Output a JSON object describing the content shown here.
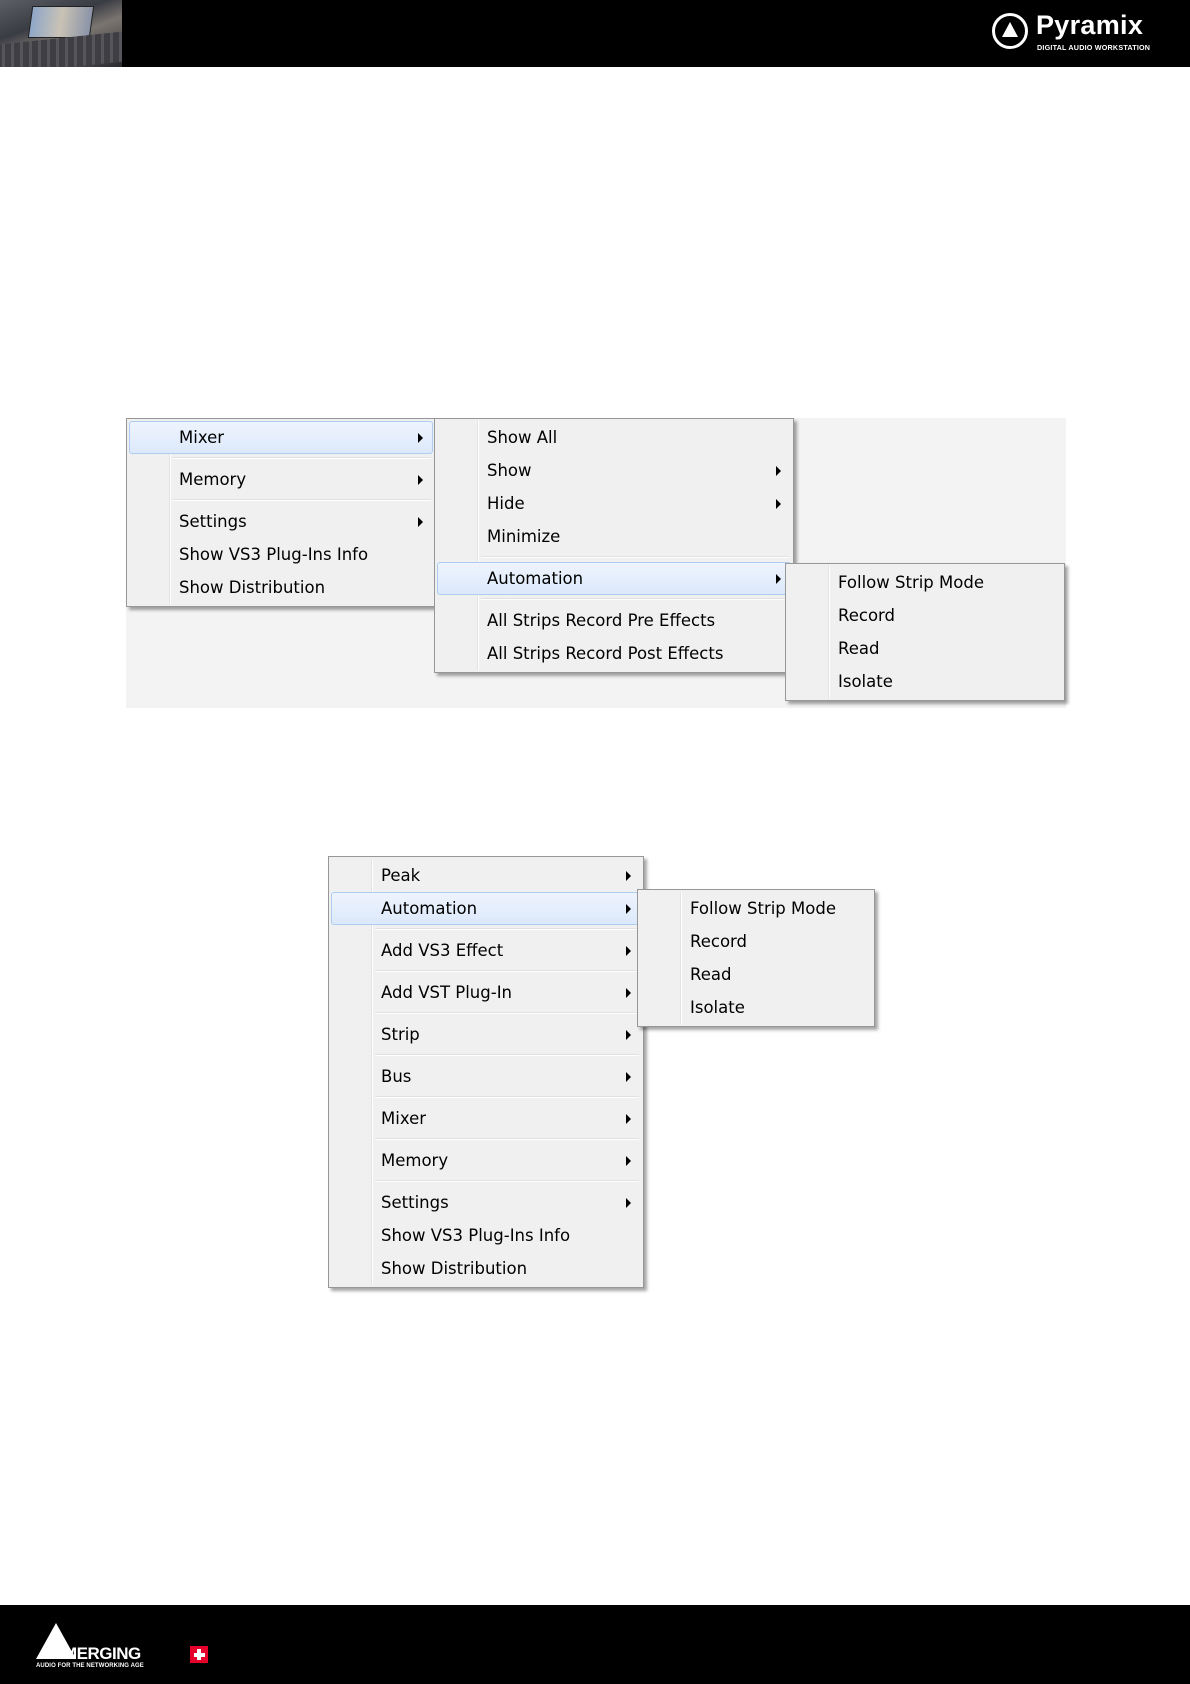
{
  "header": {
    "brand_name": "Pyramix",
    "brand_subtitle": "DIGITAL AUDIO WORKSTATION",
    "photo_icon": "studio-photo",
    "logo_icon": "pyramix-triangle-logo"
  },
  "footer": {
    "brand_name": "MERGING",
    "brand_subtitle": "AUDIO FOR THE NETWORKING AGE",
    "logo_icon": "merging-triangle-logo",
    "flag_icon": "swiss-cross"
  },
  "figure1": {
    "main_menu": [
      {
        "label": "Mixer",
        "submenu": true,
        "highlighted": true
      },
      {
        "separator": true
      },
      {
        "label": "Memory",
        "submenu": true
      },
      {
        "separator": true
      },
      {
        "label": "Settings",
        "submenu": true
      },
      {
        "label": "Show VS3 Plug-Ins Info",
        "submenu": false
      },
      {
        "label": "Show Distribution",
        "submenu": false
      }
    ],
    "mixer_submenu": [
      {
        "label": "Show All",
        "submenu": false
      },
      {
        "label": "Show",
        "submenu": true
      },
      {
        "label": "Hide",
        "submenu": true
      },
      {
        "label": "Minimize",
        "submenu": false
      },
      {
        "separator": true
      },
      {
        "label": "Automation",
        "submenu": true,
        "highlighted": true
      },
      {
        "separator": true
      },
      {
        "label": "All Strips Record Pre Effects",
        "submenu": false
      },
      {
        "label": "All Strips Record Post Effects",
        "submenu": false
      }
    ],
    "automation_submenu": [
      {
        "label": "Follow Strip Mode"
      },
      {
        "label": "Record"
      },
      {
        "label": "Read"
      },
      {
        "label": "Isolate"
      }
    ]
  },
  "figure2": {
    "main_menu": [
      {
        "label": "Peak",
        "submenu": true
      },
      {
        "label": "Automation",
        "submenu": true,
        "highlighted": true
      },
      {
        "separator": true
      },
      {
        "label": "Add VS3 Effect",
        "submenu": true
      },
      {
        "separator": true
      },
      {
        "label": "Add VST Plug-In",
        "submenu": true
      },
      {
        "separator": true
      },
      {
        "label": "Strip",
        "submenu": true
      },
      {
        "separator": true
      },
      {
        "label": "Bus",
        "submenu": true
      },
      {
        "separator": true
      },
      {
        "label": "Mixer",
        "submenu": true
      },
      {
        "separator": true
      },
      {
        "label": "Memory",
        "submenu": true
      },
      {
        "separator": true
      },
      {
        "label": "Settings",
        "submenu": true
      },
      {
        "label": "Show VS3 Plug-Ins Info",
        "submenu": false
      },
      {
        "label": "Show Distribution",
        "submenu": false
      }
    ],
    "automation_submenu": [
      {
        "label": "Follow Strip Mode"
      },
      {
        "label": "Record"
      },
      {
        "label": "Read"
      },
      {
        "label": "Isolate"
      }
    ]
  }
}
